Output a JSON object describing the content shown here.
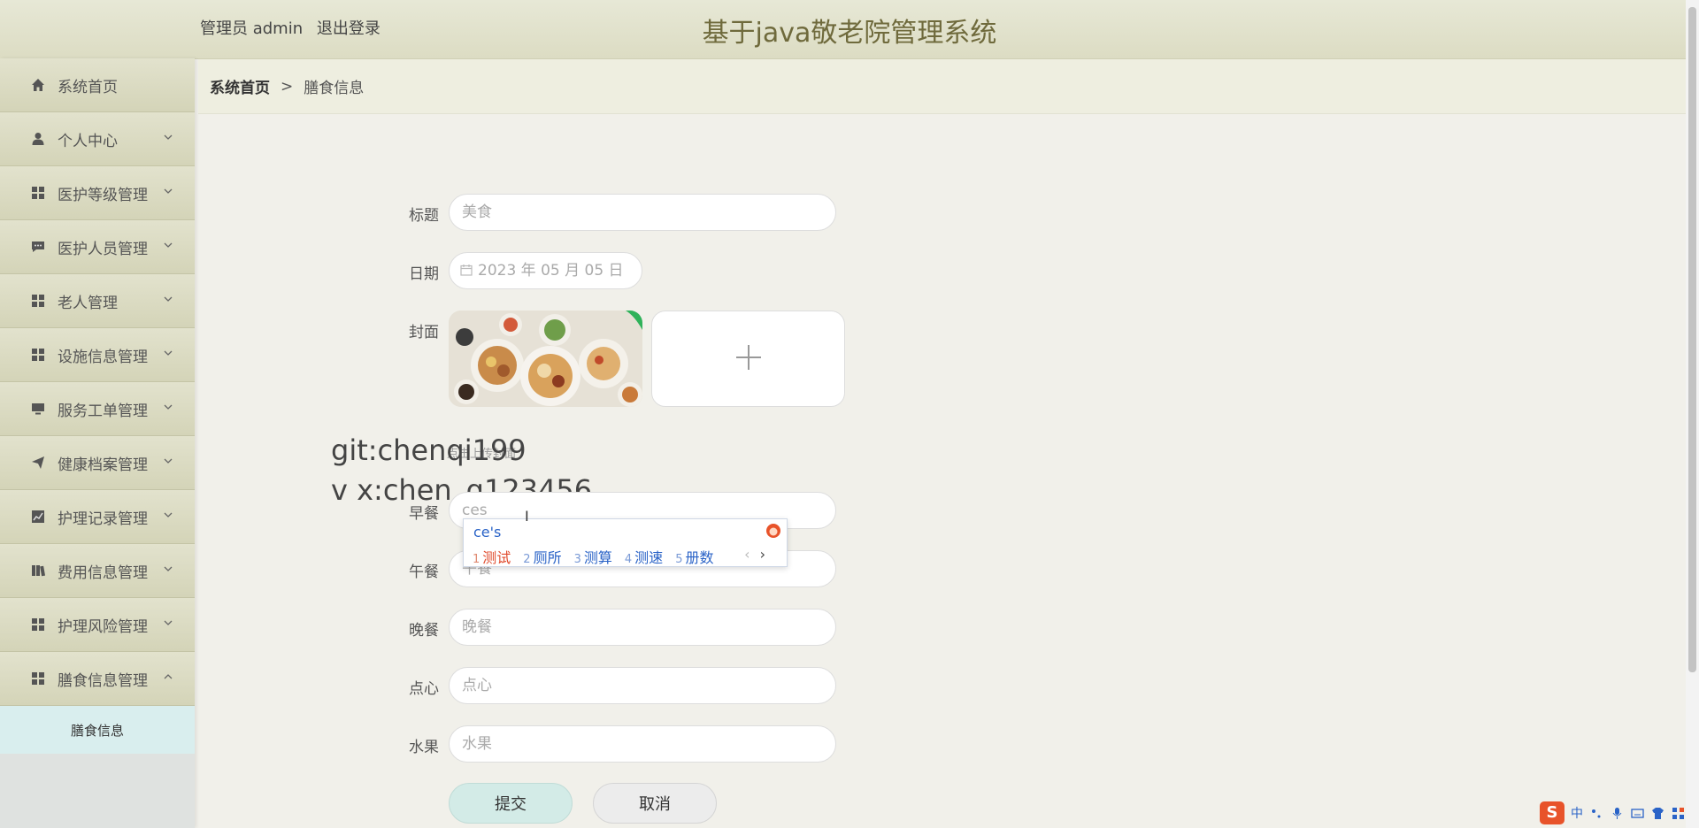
{
  "header": {
    "user_role": "管理员 admin",
    "logout": "退出登录",
    "title": "基于java敬老院管理系统"
  },
  "sidebar": {
    "items": [
      {
        "label": "系统首页",
        "icon": "home-icon"
      },
      {
        "label": "个人中心",
        "icon": "user-icon"
      },
      {
        "label": "医护等级管理",
        "icon": "grid-icon"
      },
      {
        "label": "医护人员管理",
        "icon": "chat-icon"
      },
      {
        "label": "老人管理",
        "icon": "grid-icon"
      },
      {
        "label": "设施信息管理",
        "icon": "grid-icon"
      },
      {
        "label": "服务工单管理",
        "icon": "monitor-icon"
      },
      {
        "label": "健康档案管理",
        "icon": "send-icon"
      },
      {
        "label": "护理记录管理",
        "icon": "chart-icon"
      },
      {
        "label": "费用信息管理",
        "icon": "book-icon"
      },
      {
        "label": "护理风险管理",
        "icon": "grid-icon"
      },
      {
        "label": "膳食信息管理",
        "icon": "grid-icon"
      }
    ],
    "submenu_label": "膳食信息"
  },
  "breadcrumb": {
    "home": "系统首页",
    "separator": ">",
    "current": "膳食信息"
  },
  "form": {
    "title_label": "标题",
    "title_value": "美食",
    "date_label": "日期",
    "date_value": "2023 年 05 月 05 日",
    "cover_label": "封面",
    "cover_hint": "点击上传封面",
    "breakfast_label": "早餐",
    "breakfast_value": "ces",
    "lunch_label": "午餐",
    "lunch_value": "午餐",
    "dinner_label": "晚餐",
    "dinner_placeholder": "晚餐",
    "snack_label": "点心",
    "snack_placeholder": "点心",
    "fruit_label": "水果",
    "fruit_placeholder": "水果",
    "submit_label": "提交",
    "cancel_label": "取消"
  },
  "watermark": {
    "line1": "git:chenqi199",
    "line2": "v x:chen_q123456"
  },
  "ime": {
    "composition": "ce's",
    "candidates": [
      {
        "n": "1",
        "text": "测试"
      },
      {
        "n": "2",
        "text": "厕所"
      },
      {
        "n": "3",
        "text": "测算"
      },
      {
        "n": "4",
        "text": "测速"
      },
      {
        "n": "5",
        "text": "册数"
      }
    ],
    "prev": "‹",
    "next": "›"
  },
  "tray": {
    "ime_logo": "S",
    "ime_mode": "中"
  },
  "colors": {
    "header_bg": "#dcdcc3",
    "title_color": "#6f6a3c",
    "submit_bg": "#d3ebe7",
    "submenu_bg": "#d9eeee"
  }
}
